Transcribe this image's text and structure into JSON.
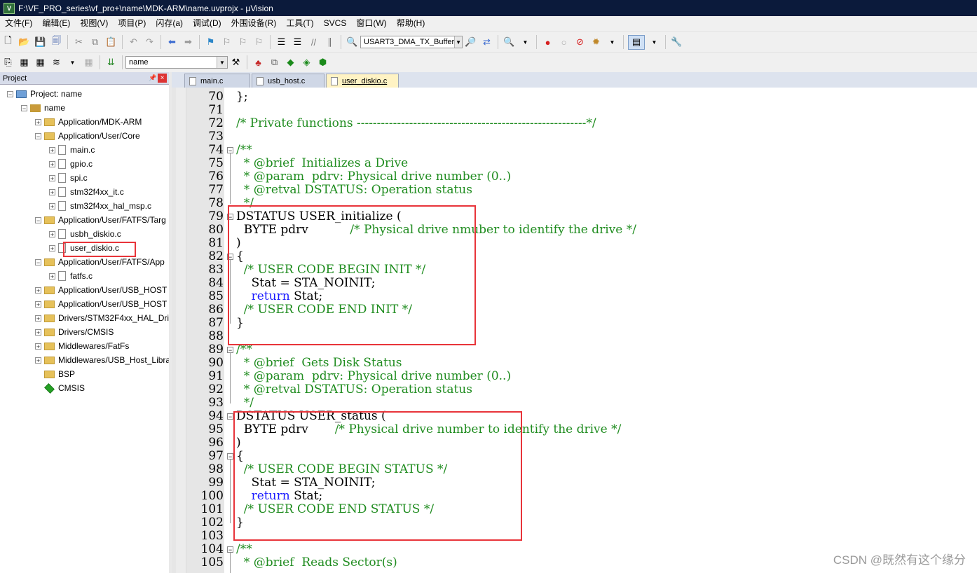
{
  "window": {
    "title": "F:\\VF_PRO_series\\vf_pro+\\name\\MDK-ARM\\name.uvprojx - µVision"
  },
  "menu": [
    "文件(F)",
    "编辑(E)",
    "视图(V)",
    "项目(P)",
    "闪存(a)",
    "调试(D)",
    "外围设备(R)",
    "工具(T)",
    "SVCS",
    "窗口(W)",
    "帮助(H)"
  ],
  "toolbar": {
    "target_combo": "USART3_DMA_TX_Buffer",
    "target_name_combo": "name"
  },
  "project_panel": {
    "title": "Project",
    "tree": [
      {
        "label": "Project: name",
        "level": 0,
        "kind": "project",
        "exp": "−"
      },
      {
        "label": "name",
        "level": 1,
        "kind": "target",
        "exp": "−"
      },
      {
        "label": "Application/MDK-ARM",
        "level": 2,
        "kind": "folder",
        "exp": "+"
      },
      {
        "label": "Application/User/Core",
        "level": 2,
        "kind": "folder",
        "exp": "−"
      },
      {
        "label": "main.c",
        "level": 3,
        "kind": "file",
        "exp": "+"
      },
      {
        "label": "gpio.c",
        "level": 3,
        "kind": "file",
        "exp": "+"
      },
      {
        "label": "spi.c",
        "level": 3,
        "kind": "file",
        "exp": "+"
      },
      {
        "label": "stm32f4xx_it.c",
        "level": 3,
        "kind": "file",
        "exp": "+"
      },
      {
        "label": "stm32f4xx_hal_msp.c",
        "level": 3,
        "kind": "file",
        "exp": "+"
      },
      {
        "label": "Application/User/FATFS/Targ",
        "level": 2,
        "kind": "folder",
        "exp": "−"
      },
      {
        "label": "usbh_diskio.c",
        "level": 3,
        "kind": "file",
        "exp": "+"
      },
      {
        "label": "user_diskio.c",
        "level": 3,
        "kind": "file",
        "exp": "+"
      },
      {
        "label": "Application/User/FATFS/App",
        "level": 2,
        "kind": "folder",
        "exp": "−"
      },
      {
        "label": "fatfs.c",
        "level": 3,
        "kind": "file",
        "exp": "+"
      },
      {
        "label": "Application/User/USB_HOST",
        "level": 2,
        "kind": "folder",
        "exp": "+"
      },
      {
        "label": "Application/User/USB_HOST",
        "level": 2,
        "kind": "folder",
        "exp": "+"
      },
      {
        "label": "Drivers/STM32F4xx_HAL_Driv",
        "level": 2,
        "kind": "folder",
        "exp": "+"
      },
      {
        "label": "Drivers/CMSIS",
        "level": 2,
        "kind": "folder",
        "exp": "+"
      },
      {
        "label": "Middlewares/FatFs",
        "level": 2,
        "kind": "folder",
        "exp": "+"
      },
      {
        "label": "Middlewares/USB_Host_Libra",
        "level": 2,
        "kind": "folder",
        "exp": "+"
      },
      {
        "label": "BSP",
        "level": 2,
        "kind": "folder",
        "exp": ""
      },
      {
        "label": "CMSIS",
        "level": 2,
        "kind": "component",
        "exp": ""
      }
    ]
  },
  "tabs": [
    "main.c",
    "usb_host.c",
    "user_diskio.c"
  ],
  "code_lines": [
    {
      "n": "70",
      "t": "};",
      "c": "plain"
    },
    {
      "n": "71",
      "t": "",
      "c": "plain"
    },
    {
      "n": "72",
      "t": "/* Private functions ---------------------------------------------------------*/",
      "c": "comment"
    },
    {
      "n": "73",
      "t": "",
      "c": "plain"
    },
    {
      "n": "74",
      "t": "/**",
      "c": "comment",
      "fold": "−"
    },
    {
      "n": "75",
      "t": "  * @brief  Initializes a Drive",
      "c": "comment"
    },
    {
      "n": "76",
      "t": "  * @param  pdrv: Physical drive number (0..)",
      "c": "comment"
    },
    {
      "n": "77",
      "t": "  * @retval DSTATUS: Operation status",
      "c": "comment"
    },
    {
      "n": "78",
      "t": "  */",
      "c": "comment"
    },
    {
      "n": "79",
      "t": "DSTATUS USER_initialize (",
      "c": "plain",
      "fold": "−"
    },
    {
      "n": "80",
      "t": "  BYTE pdrv           /* Physical drive nmuber to identify the drive */",
      "c": "mixed80"
    },
    {
      "n": "81",
      "t": ")",
      "c": "plain"
    },
    {
      "n": "82",
      "t": "{",
      "c": "plain",
      "fold": "−"
    },
    {
      "n": "83",
      "t": "  /* USER CODE BEGIN INIT */",
      "c": "comment"
    },
    {
      "n": "84",
      "t": "    Stat = STA_NOINIT;",
      "c": "plain"
    },
    {
      "n": "85",
      "t": "    return Stat;",
      "c": "ret"
    },
    {
      "n": "86",
      "t": "  /* USER CODE END INIT */",
      "c": "comment"
    },
    {
      "n": "87",
      "t": "}",
      "c": "plain"
    },
    {
      "n": "88",
      "t": "",
      "c": "plain"
    },
    {
      "n": "89",
      "t": "/**",
      "c": "comment",
      "fold": "−"
    },
    {
      "n": "90",
      "t": "  * @brief  Gets Disk Status",
      "c": "comment"
    },
    {
      "n": "91",
      "t": "  * @param  pdrv: Physical drive number (0..)",
      "c": "comment"
    },
    {
      "n": "92",
      "t": "  * @retval DSTATUS: Operation status",
      "c": "comment"
    },
    {
      "n": "93",
      "t": "  */",
      "c": "comment"
    },
    {
      "n": "94",
      "t": "DSTATUS USER_status (",
      "c": "plain",
      "fold": "−"
    },
    {
      "n": "95",
      "t": "  BYTE pdrv       /* Physical drive number to identify the drive */",
      "c": "mixed95"
    },
    {
      "n": "96",
      "t": ")",
      "c": "plain"
    },
    {
      "n": "97",
      "t": "{",
      "c": "plain",
      "fold": "−"
    },
    {
      "n": "98",
      "t": "  /* USER CODE BEGIN STATUS */",
      "c": "comment"
    },
    {
      "n": "99",
      "t": "    Stat = STA_NOINIT;",
      "c": "plain"
    },
    {
      "n": "100",
      "t": "    return Stat;",
      "c": "ret"
    },
    {
      "n": "101",
      "t": "  /* USER CODE END STATUS */",
      "c": "comment"
    },
    {
      "n": "102",
      "t": "}",
      "c": "plain"
    },
    {
      "n": "103",
      "t": "",
      "c": "plain"
    },
    {
      "n": "104",
      "t": "/**",
      "c": "comment",
      "fold": "−"
    },
    {
      "n": "105",
      "t": "  * @brief  Reads Sector(s)",
      "c": "comment"
    }
  ],
  "watermark": "CSDN @既然有这个缘分",
  "colors": {
    "comment": "#1f8c1f",
    "keyword": "#1a1aff",
    "highlight_box": "#e8343a",
    "titlebar": "#0b1a3b"
  }
}
